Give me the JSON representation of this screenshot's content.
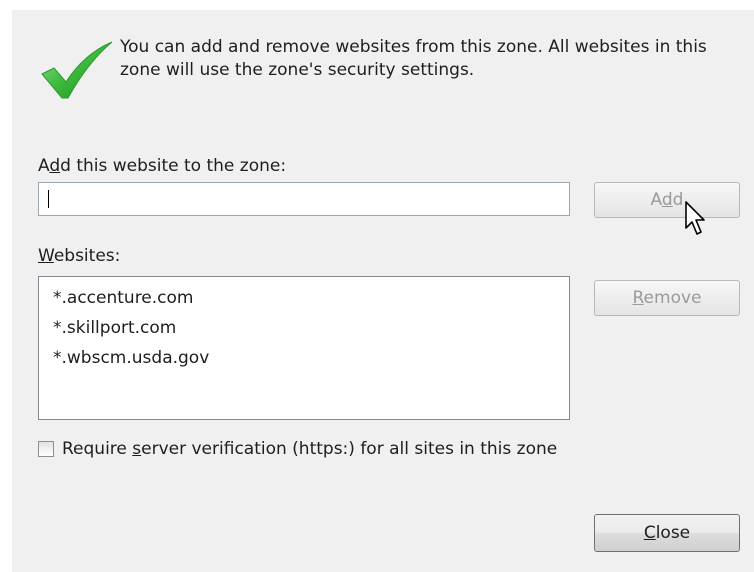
{
  "intro_text": "You can add and remove websites from this zone. All websites in this zone will use the zone's security settings.",
  "add_field": {
    "label_pre": "A",
    "label_mnemonic": "d",
    "label_post": "d this website to the zone:",
    "value": "",
    "placeholder": ""
  },
  "add_button": {
    "label_pre": "A",
    "label_mnemonic": "d",
    "label_post": "d",
    "enabled": false
  },
  "websites": {
    "label_mnemonic": "W",
    "label_post": "ebsites:",
    "items": [
      "*.accenture.com",
      "*.skillport.com",
      "*.wbscm.usda.gov"
    ]
  },
  "remove_button": {
    "label_mnemonic": "R",
    "label_post": "emove",
    "enabled": false
  },
  "require_verification": {
    "label_pre": "Require ",
    "label_mnemonic": "s",
    "label_post": "erver verification (https:) for all sites in this zone",
    "checked": false
  },
  "close_button": {
    "label_mnemonic": "C",
    "label_post": "lose"
  },
  "icons": {
    "status": "green-check-icon",
    "pointer": "mouse-cursor-icon"
  },
  "colors": {
    "check_green": "#3cb83c",
    "dialog_bg": "#f0f0f0",
    "disabled_text": "#9a9a9a"
  }
}
